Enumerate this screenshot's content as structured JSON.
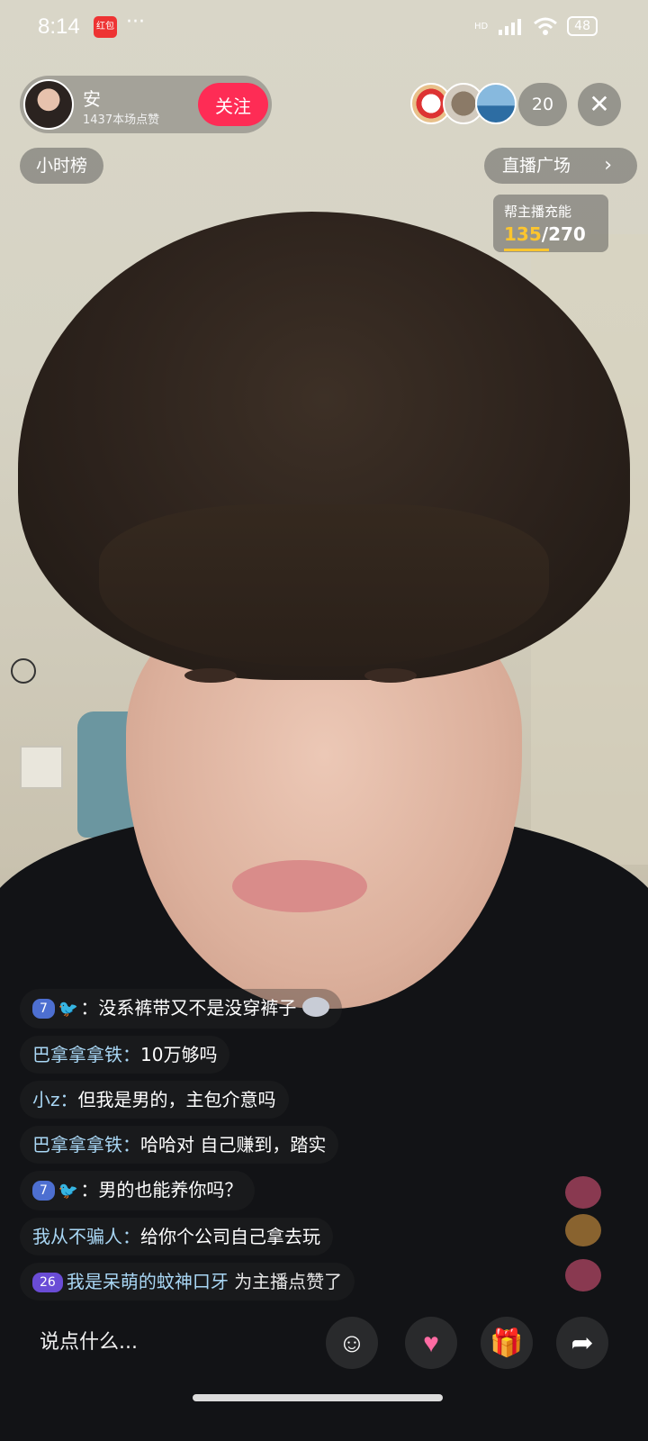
{
  "status_bar": {
    "time": "8:14",
    "app_icon_text": "红包",
    "dots": "···",
    "hd": "HD",
    "battery": "48"
  },
  "anchor": {
    "name": "安",
    "likes": "1437本场点赞",
    "follow_label": "关注"
  },
  "viewers": {
    "count": "20"
  },
  "nav": {
    "hourly_rank": "小时榜",
    "live_plaza": "直播广场"
  },
  "energy": {
    "label": "帮主播充能",
    "current": "135",
    "separator": "/",
    "total": "270"
  },
  "chat": [
    {
      "badge": "7",
      "user": "",
      "text": "没系裤带又不是没穿裤子"
    },
    {
      "badge": "",
      "user": "巴拿拿拿铁：",
      "text": "10万够吗"
    },
    {
      "badge": "",
      "user": "小z：",
      "text": "但我是男的，主包介意吗"
    },
    {
      "badge": "",
      "user": "巴拿拿拿铁：",
      "text": "哈哈对 自己赚到，踏实"
    },
    {
      "badge": "7",
      "user": "",
      "text": "男的也能养你吗？"
    },
    {
      "badge": "",
      "user": "我从不骗人：",
      "text": "给你个公司自己拿去玩"
    },
    {
      "badge": "26",
      "user": "我是呆萌的蚊神口牙",
      "text": "为主播点赞了"
    }
  ],
  "input": {
    "placeholder": "说点什么..."
  },
  "colors": {
    "follow": "#fe2c55",
    "energy_current": "#fcc52e",
    "username": "#a9d7f5"
  },
  "icons": [
    "emoji-icon",
    "heart-planet-icon",
    "gift-icon",
    "share-icon",
    "close-icon",
    "chevron-right-icon"
  ]
}
